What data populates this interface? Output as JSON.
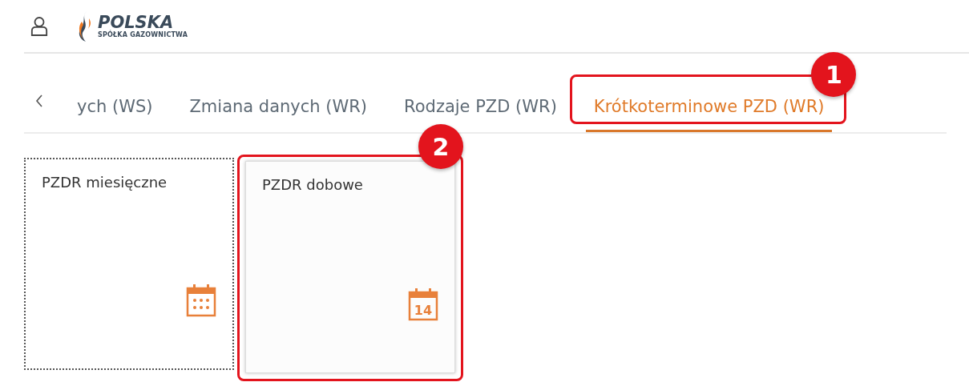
{
  "header": {
    "logo": {
      "name": "POLSKA",
      "subtitle": "SPÓŁKA GAZOWNICTWA"
    }
  },
  "tabs": [
    {
      "label": "ych (WS)",
      "selected": false
    },
    {
      "label": "Zmiana danych (WR)",
      "selected": false
    },
    {
      "label": "Rodzaje PZD (WR)",
      "selected": false
    },
    {
      "label": "Krótkoterminowe PZD (WR)",
      "selected": true,
      "callout": "1"
    }
  ],
  "tiles": [
    {
      "title": "PZDR miesięczne",
      "kind": "calendar",
      "focused": true
    },
    {
      "title": "PZDR dobowe",
      "kind": "calendar-day",
      "day": "14",
      "focused": false,
      "callout": "2"
    }
  ]
}
